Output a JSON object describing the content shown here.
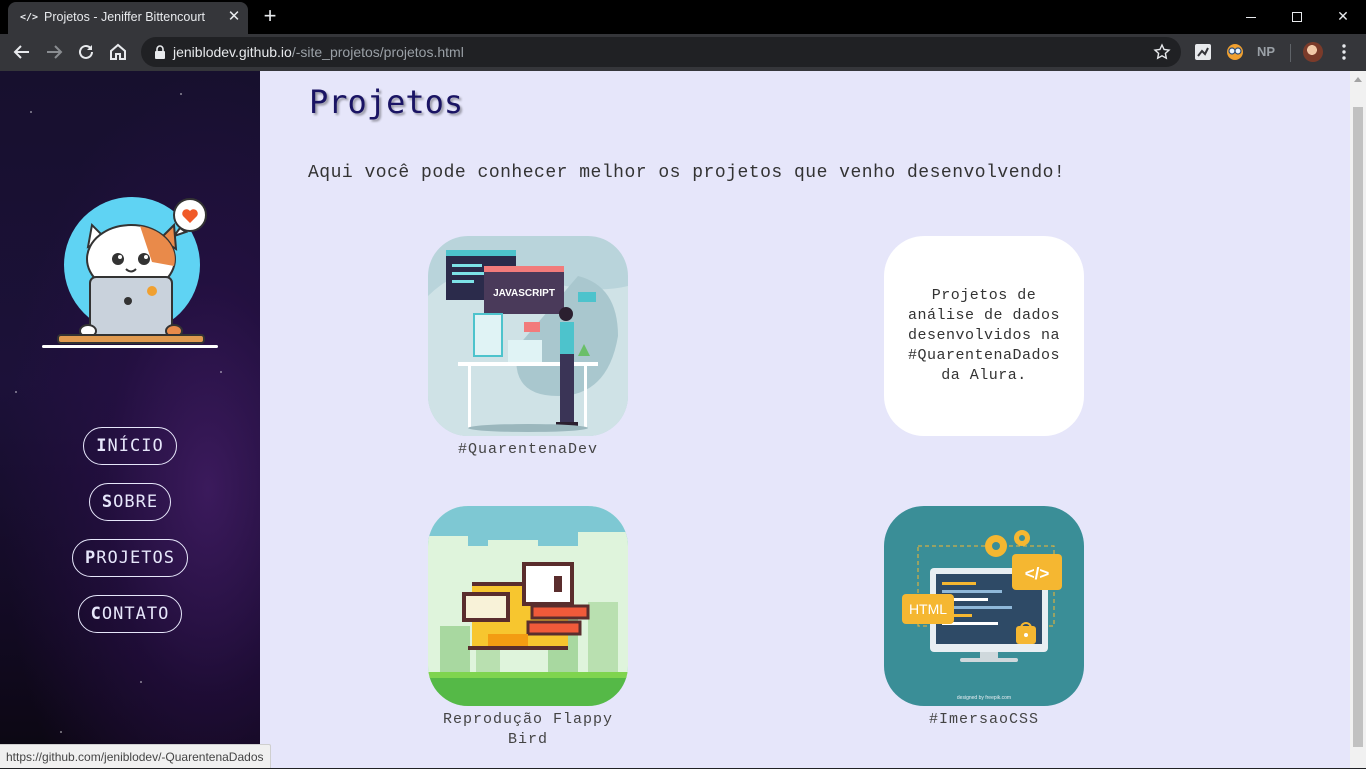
{
  "browser": {
    "tab_title": "Projetos - Jeniffer Bittencourt",
    "tab_favicon": "</>",
    "url_host": "jeniblodev.github.io",
    "url_path": "/-site_projetos/projetos.html",
    "profile_ext_label": "NP"
  },
  "sidebar": {
    "nav": [
      {
        "label": "INÍCIO"
      },
      {
        "label": "SOBRE"
      },
      {
        "label": "PROJETOS"
      },
      {
        "label": "CONTATO"
      }
    ]
  },
  "main": {
    "title": "Projetos",
    "intro": "Aqui você pode conhecer melhor os projetos que venho desenvolvendo!",
    "projects": [
      {
        "caption": "#QuarentenaDev",
        "image_text": "JAVASCRIPT"
      },
      {
        "card_text": "Projetos de análise de dados desenvolvidos na #QuarentenaDados da Alura."
      },
      {
        "caption": "Reprodução Flappy Bird"
      },
      {
        "caption": "#ImersaoCSS",
        "image_text_1": "</>",
        "image_text_2": "HTML",
        "image_credit": "designed by freepik.com"
      }
    ]
  },
  "status_url": "https://github.com/jeniblodev/-QuarentenaDados",
  "colors": {
    "page_bg": "#e6e6fa",
    "title": "#1a1464",
    "sidebar_bg": "#17102e"
  }
}
